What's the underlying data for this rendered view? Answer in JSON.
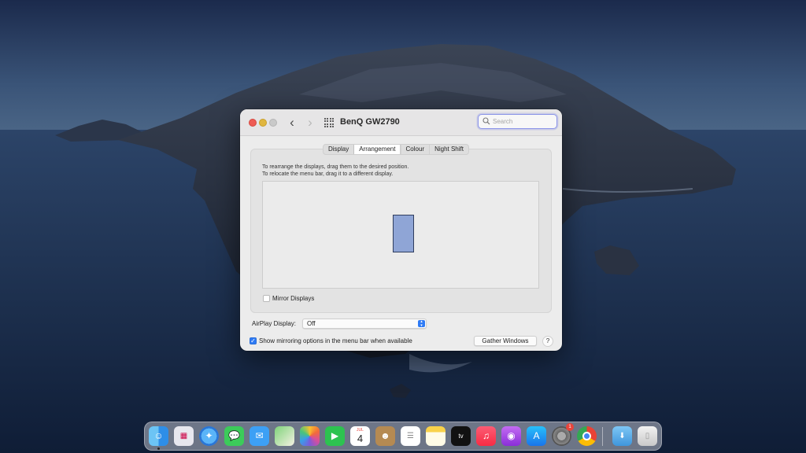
{
  "window": {
    "title": "BenQ GW2790",
    "search_placeholder": "Search",
    "nav_back": "‹",
    "nav_forward": "›"
  },
  "tabs": [
    {
      "label": "Display",
      "active": false
    },
    {
      "label": "Arrangement",
      "active": true
    },
    {
      "label": "Colour",
      "active": false
    },
    {
      "label": "Night Shift",
      "active": false
    }
  ],
  "arrangement": {
    "instruction_1": "To rearrange the displays, drag them to the desired position.",
    "instruction_2": "To relocate the menu bar, drag it to a different display."
  },
  "mirror": {
    "label": "Mirror Displays",
    "checked": false
  },
  "airplay": {
    "label": "AirPlay Display:",
    "value": "Off"
  },
  "mirroring_menu": {
    "label": "Show mirroring options in the menu bar when available",
    "checked": true
  },
  "buttons": {
    "gather": "Gather Windows",
    "help": "?"
  },
  "dock": {
    "calendar_month": "JUL",
    "calendar_day": "4",
    "settings_badge": "1",
    "apps": [
      "Finder",
      "Launchpad",
      "Safari",
      "Messages",
      "Mail",
      "Maps",
      "Photos",
      "FaceTime",
      "Calendar",
      "Contacts",
      "Reminders",
      "Notes",
      "TV",
      "Music",
      "Podcasts",
      "App Store",
      "System Preferences",
      "Chrome",
      "Downloads",
      "Trash"
    ]
  },
  "colors": {
    "accent": "#2f7bf5",
    "display_fill": "#8fa5d6",
    "close": "#ee5c55",
    "minimize": "#e0b640"
  }
}
